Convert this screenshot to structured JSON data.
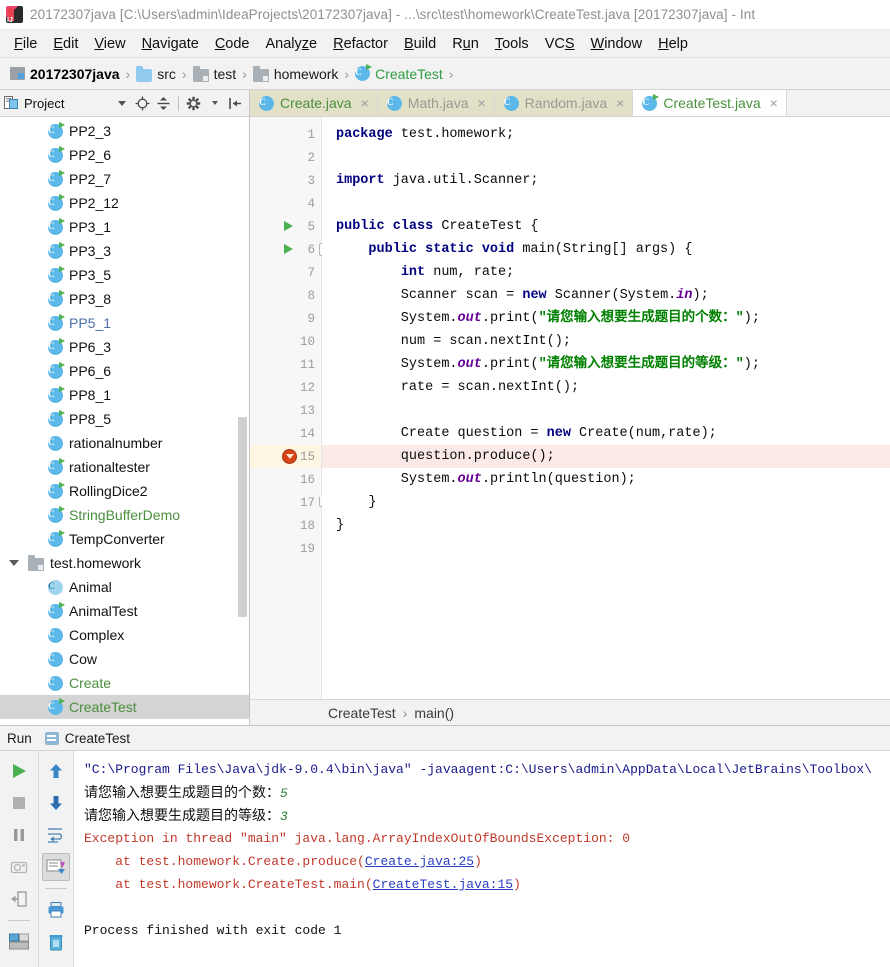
{
  "window": {
    "title": "20172307java [C:\\Users\\admin\\IdeaProjects\\20172307java] - ...\\src\\test\\homework\\CreateTest.java [20172307java] - Int",
    "logo_icon": "intellij-idea-icon"
  },
  "menubar": {
    "items": [
      {
        "label": "File",
        "mnemonic": "F"
      },
      {
        "label": "Edit",
        "mnemonic": "E"
      },
      {
        "label": "View",
        "mnemonic": "V"
      },
      {
        "label": "Navigate",
        "mnemonic": "N"
      },
      {
        "label": "Code",
        "mnemonic": "C"
      },
      {
        "label": "Analyze",
        "mnemonic": "z"
      },
      {
        "label": "Refactor",
        "mnemonic": "R"
      },
      {
        "label": "Build",
        "mnemonic": "B"
      },
      {
        "label": "Run",
        "mnemonic": "u"
      },
      {
        "label": "Tools",
        "mnemonic": "T"
      },
      {
        "label": "VCS",
        "mnemonic": "S"
      },
      {
        "label": "Window",
        "mnemonic": "W"
      },
      {
        "label": "Help",
        "mnemonic": "H"
      }
    ]
  },
  "navbar": {
    "crumbs": [
      {
        "label": "20172307java",
        "icon": "module-icon",
        "style": "bold"
      },
      {
        "label": "src",
        "icon": "folder-source-icon",
        "style": "normal"
      },
      {
        "label": "test",
        "icon": "folder-icon",
        "style": "normal"
      },
      {
        "label": "homework",
        "icon": "folder-icon",
        "style": "normal"
      },
      {
        "label": "CreateTest",
        "icon": "java-class-runnable-icon",
        "style": "green"
      }
    ],
    "separator": "›"
  },
  "project_panel": {
    "title": "Project",
    "toolbar_icons": [
      "project-view-icon",
      "chevron-down-icon",
      "locate-icon",
      "collapse-all-icon",
      "settings-gear-icon",
      "hide-panel-icon"
    ],
    "tree": [
      {
        "label": "PP2_3",
        "icon": "java-class-runnable-icon",
        "indent": 2,
        "color": "default",
        "selected": false
      },
      {
        "label": "PP2_6",
        "icon": "java-class-runnable-icon",
        "indent": 2,
        "color": "default",
        "selected": false
      },
      {
        "label": "PP2_7",
        "icon": "java-class-runnable-icon",
        "indent": 2,
        "color": "default",
        "selected": false
      },
      {
        "label": "PP2_12",
        "icon": "java-class-runnable-icon",
        "indent": 2,
        "color": "default",
        "selected": false
      },
      {
        "label": "PP3_1",
        "icon": "java-class-runnable-icon",
        "indent": 2,
        "color": "default",
        "selected": false
      },
      {
        "label": "PP3_3",
        "icon": "java-class-runnable-icon",
        "indent": 2,
        "color": "default",
        "selected": false
      },
      {
        "label": "PP3_5",
        "icon": "java-class-runnable-icon",
        "indent": 2,
        "color": "default",
        "selected": false
      },
      {
        "label": "PP3_8",
        "icon": "java-class-runnable-icon",
        "indent": 2,
        "color": "default",
        "selected": false
      },
      {
        "label": "PP5_1",
        "icon": "java-class-runnable-icon",
        "indent": 2,
        "color": "blue",
        "selected": false
      },
      {
        "label": "PP6_3",
        "icon": "java-class-runnable-icon",
        "indent": 2,
        "color": "default",
        "selected": false
      },
      {
        "label": "PP6_6",
        "icon": "java-class-runnable-icon",
        "indent": 2,
        "color": "default",
        "selected": false
      },
      {
        "label": "PP8_1",
        "icon": "java-class-runnable-icon",
        "indent": 2,
        "color": "default",
        "selected": false
      },
      {
        "label": "PP8_5",
        "icon": "java-class-runnable-icon",
        "indent": 2,
        "color": "default",
        "selected": false
      },
      {
        "label": "rationalnumber",
        "icon": "java-class-icon",
        "indent": 2,
        "color": "default",
        "selected": false
      },
      {
        "label": "rationaltester",
        "icon": "java-class-runnable-icon",
        "indent": 2,
        "color": "default",
        "selected": false
      },
      {
        "label": "RollingDice2",
        "icon": "java-class-runnable-icon",
        "indent": 2,
        "color": "default",
        "selected": false
      },
      {
        "label": "StringBufferDemo",
        "icon": "java-class-runnable-icon",
        "indent": 2,
        "color": "green",
        "selected": false
      },
      {
        "label": "TempConverter",
        "icon": "java-class-runnable-icon",
        "indent": 2,
        "color": "default",
        "selected": false
      },
      {
        "label": "test.homework",
        "icon": "package-folder-icon",
        "indent": 1,
        "color": "default",
        "selected": false,
        "expanded": true
      },
      {
        "label": "Animal",
        "icon": "java-class-abstract-icon",
        "indent": 2,
        "color": "default",
        "selected": false
      },
      {
        "label": "AnimalTest",
        "icon": "java-class-runnable-icon",
        "indent": 2,
        "color": "default",
        "selected": false
      },
      {
        "label": "Complex",
        "icon": "java-class-icon",
        "indent": 2,
        "color": "default",
        "selected": false
      },
      {
        "label": "Cow",
        "icon": "java-class-icon",
        "indent": 2,
        "color": "default",
        "selected": false
      },
      {
        "label": "Create",
        "icon": "java-class-icon",
        "indent": 2,
        "color": "green",
        "selected": false
      },
      {
        "label": "CreateTest",
        "icon": "java-class-runnable-icon",
        "indent": 2,
        "color": "green",
        "selected": true
      }
    ]
  },
  "editor": {
    "tabs": [
      {
        "label": "Create.java",
        "icon": "java-class-icon",
        "active": false,
        "style": "green",
        "close": "×"
      },
      {
        "label": "Math.java",
        "icon": "java-class-icon",
        "active": false,
        "style": "dark",
        "close": "×"
      },
      {
        "label": "Random.java",
        "icon": "java-class-icon",
        "active": false,
        "style": "dark",
        "close": "×"
      },
      {
        "label": "CreateTest.java",
        "icon": "java-class-runnable-icon",
        "active": true,
        "style": "green",
        "close": "×"
      }
    ],
    "line_numbers": [
      1,
      2,
      3,
      4,
      5,
      6,
      7,
      8,
      9,
      10,
      11,
      12,
      13,
      14,
      15,
      16,
      17,
      18,
      19
    ],
    "gutter_run_arrows": [
      5,
      6
    ],
    "error_line": 15,
    "fold_markers": [
      6,
      17
    ],
    "code": [
      {
        "n": 1,
        "html": "<span class=\"kw\">package</span> test.homework;"
      },
      {
        "n": 2,
        "html": ""
      },
      {
        "n": 3,
        "html": "<span class=\"kw\">import</span> java.util.Scanner;"
      },
      {
        "n": 4,
        "html": ""
      },
      {
        "n": 5,
        "html": "<span class=\"kw\">public class</span> CreateTest {"
      },
      {
        "n": 6,
        "html": "    <span class=\"kw\">public static void</span> main(String[] args) {"
      },
      {
        "n": 7,
        "html": "        <span class=\"kw\">int</span> num, rate;"
      },
      {
        "n": 8,
        "html": "        Scanner scan = <span class=\"kw\">new</span> Scanner(System.<span class=\"fieldi\">in</span>);"
      },
      {
        "n": 9,
        "html": "        System.<span class=\"fieldi\">out</span>.print(<span class=\"str\">\"请您输入想要生成题目的个数：\"</span>);"
      },
      {
        "n": 10,
        "html": "        num = scan.nextInt();"
      },
      {
        "n": 11,
        "html": "        System.<span class=\"fieldi\">out</span>.print(<span class=\"str\">\"请您输入想要生成题目的等级：\"</span>);"
      },
      {
        "n": 12,
        "html": "        rate = scan.nextInt();"
      },
      {
        "n": 13,
        "html": ""
      },
      {
        "n": 14,
        "html": "        Create question = <span class=\"kw\">new</span> Create(num,rate);"
      },
      {
        "n": 15,
        "html": "        question.produce();",
        "highlight": true
      },
      {
        "n": 16,
        "html": "        System.<span class=\"fieldi\">out</span>.println(question);"
      },
      {
        "n": 17,
        "html": "    }"
      },
      {
        "n": 18,
        "html": "}"
      },
      {
        "n": 19,
        "html": ""
      }
    ],
    "breadcrumb": {
      "class_name": "CreateTest",
      "separator": "›",
      "method_name": "main()"
    }
  },
  "run_panel": {
    "tool_window_label": "Run",
    "config_name": "CreateTest",
    "left_icons": [
      "rerun-icon",
      "stop-icon",
      "pause-icon",
      "camera-icon",
      "exit-icon",
      "layout-icon"
    ],
    "right_icons": [
      "arrow-up-icon",
      "arrow-down-icon",
      "soft-wrap-icon",
      "scroll-to-end-icon",
      "print-icon",
      "trash-icon"
    ],
    "console": [
      {
        "type": "cmd",
        "text": "\"C:\\Program Files\\Java\\jdk-9.0.4\\bin\\java\" -javaagent:C:\\Users\\admin\\AppData\\Local\\JetBrains\\Toolbox\\"
      },
      {
        "type": "prompt",
        "text": "请您输入想要生成题目的个数：",
        "value": "5"
      },
      {
        "type": "prompt",
        "text": "请您输入想要生成题目的等级：",
        "value": "3"
      },
      {
        "type": "error",
        "text": "Exception in thread \"main\" java.lang.ArrayIndexOutOfBoundsException: 0"
      },
      {
        "type": "trace",
        "prefix": "    at test.homework.Create.produce(",
        "link": "Create.java:25",
        "suffix": ")"
      },
      {
        "type": "trace",
        "prefix": "    at test.homework.CreateTest.main(",
        "link": "CreateTest.java:15",
        "suffix": ")"
      },
      {
        "type": "blank",
        "text": ""
      },
      {
        "type": "plain",
        "text": "Process finished with exit code 1"
      }
    ]
  },
  "colors": {
    "accent_green": "#4a8f3c",
    "error_red": "#c0392b",
    "keyword_blue": "#000080",
    "string_green": "#008000",
    "link_blue": "#2b3fc4",
    "tab_inactive": "#e3e0c8",
    "selection_gray": "#d4d4d4"
  }
}
